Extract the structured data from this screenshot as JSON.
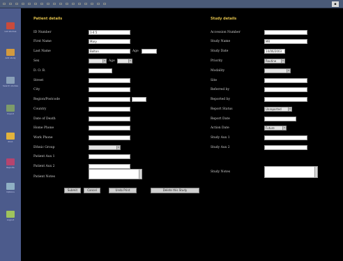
{
  "patient": {
    "title": "Patient details",
    "id_label": "ID Number",
    "id_value": "1-4 5",
    "first_label": "First Name",
    "first_value": "Mary",
    "last_label": "Last Name",
    "last_value": "Bolton",
    "sex_label": "Sex",
    "age_label": "Age",
    "dob_label": "D. O. B.",
    "street_label": "Street",
    "city_label": "City",
    "region_label": "Region/Postcode",
    "country_label": "Country",
    "death_label": "Date of Death",
    "home_phone_label": "Home Phone",
    "work_phone_label": "Work Phone",
    "ethnic_label": "Ethnic Group",
    "patient_aux1_label": "Patient Aux 1",
    "patient_aux2_label": "Patient Aux 2",
    "notes_label": "Patient Notes"
  },
  "study": {
    "title": "Study details",
    "accession_label": "Accession Number",
    "name_label": "Study Name",
    "name_value": "MR",
    "date_label": "Study Date",
    "date_value": "14/06/2003",
    "priority_label": "Priority",
    "priority_value": "Routine",
    "modality_label": "Modality",
    "site_label": "Site",
    "referrer_label": "Referred by",
    "reported_label": "Reported by",
    "report_status_label": "Report Status",
    "report_status_value": "Unreported",
    "report_date_label": "Report Date",
    "action_label": "Action Date",
    "action_value": "Future",
    "aux1_label": "Study Aux 1",
    "aux2_label": "Study Aux 2",
    "notes_label": "Study Notes"
  },
  "buttons": {
    "submit": "Submit",
    "cancel": "Cancel",
    "undo": "Undo Print",
    "delete": "Delete this Study"
  },
  "sidebar": [
    {
      "label": "List studies",
      "color": "#c94b3c"
    },
    {
      "label": "Add study",
      "color": "#d39a3e"
    },
    {
      "label": "Search studies",
      "color": "#8aa0b8"
    },
    {
      "label": "Import",
      "color": "#7d9b6a"
    },
    {
      "label": "Print",
      "color": "#e2b33c"
    },
    {
      "label": "Reports",
      "color": "#b6446e"
    },
    {
      "label": "Options",
      "color": "#8fb0c4"
    },
    {
      "label": "Logout",
      "color": "#9fc35c"
    }
  ]
}
